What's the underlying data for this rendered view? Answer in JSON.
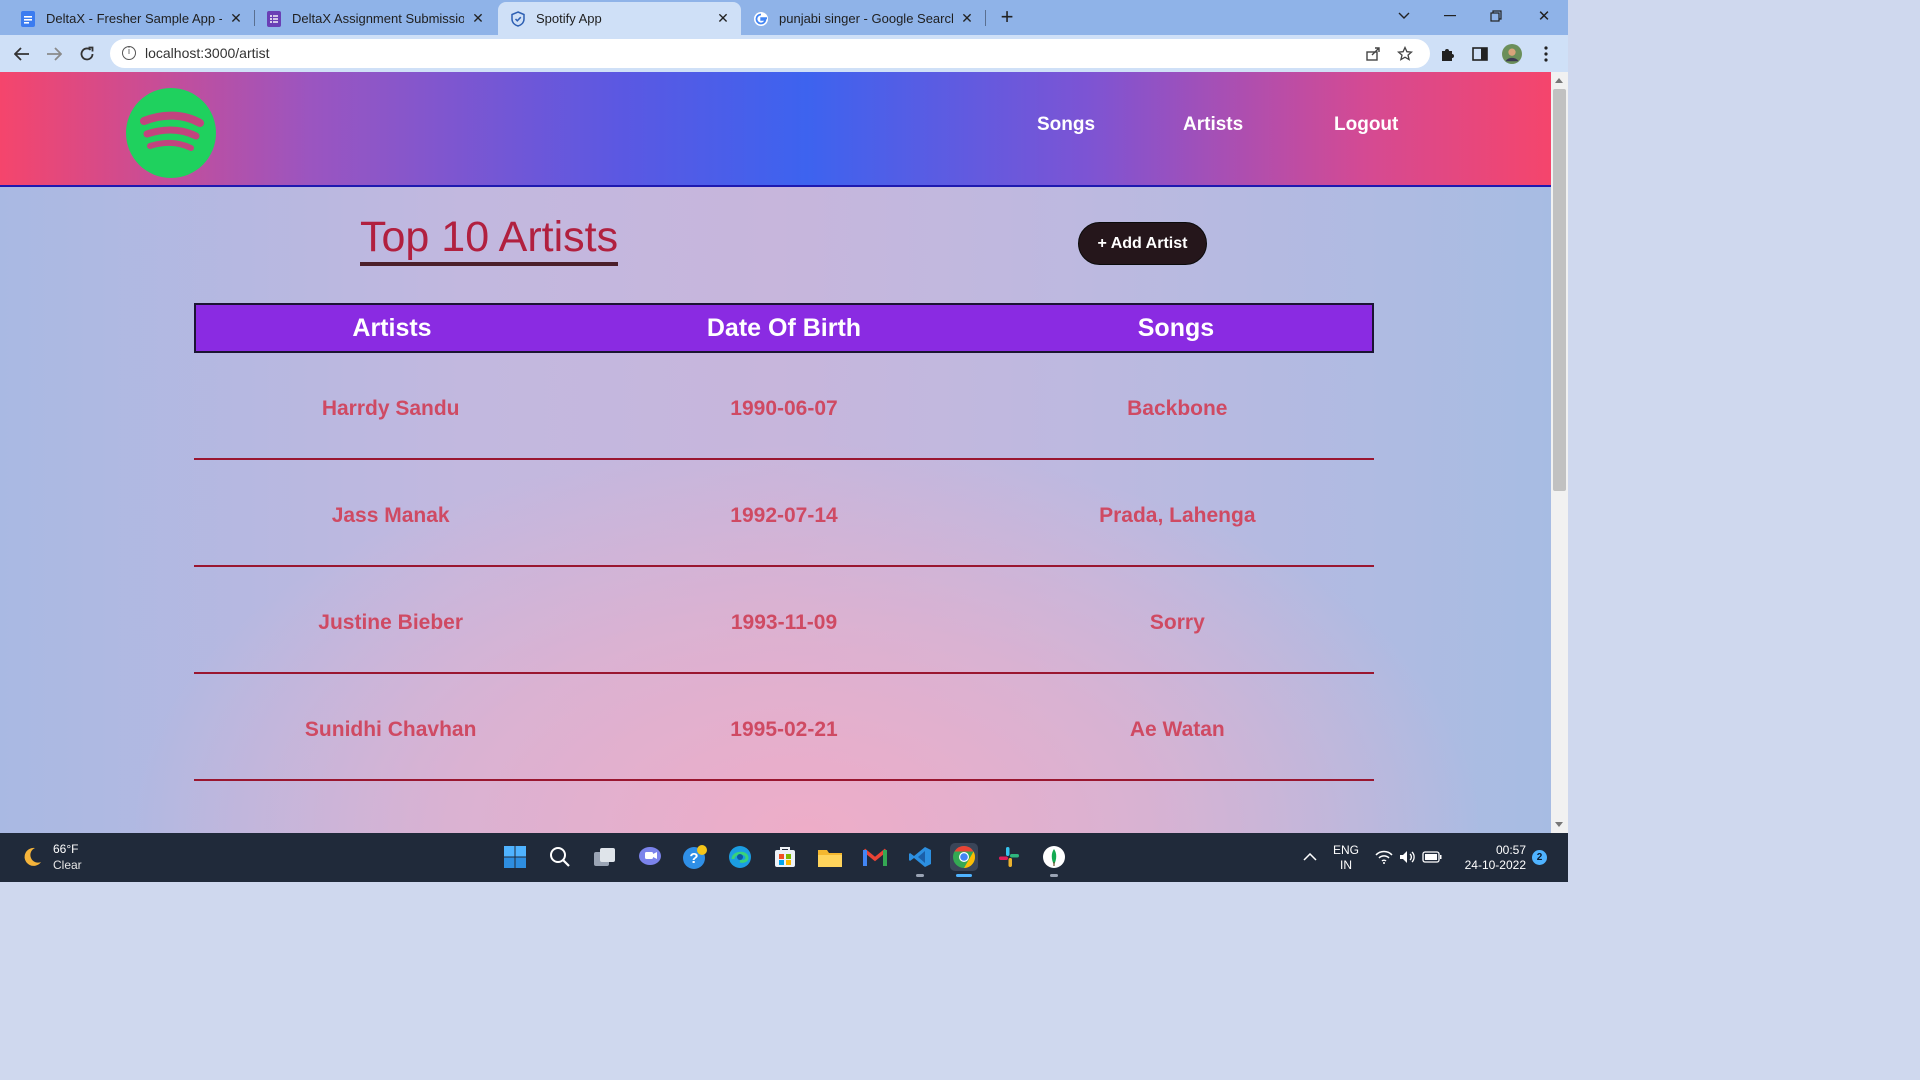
{
  "browser": {
    "tabs": [
      {
        "title": "DeltaX - Fresher Sample App - Sp",
        "favicon": "docs-icon",
        "active": false
      },
      {
        "title": "DeltaX Assignment Submission -",
        "favicon": "forms-icon",
        "active": false
      },
      {
        "title": "Spotify App",
        "favicon": "shield-icon",
        "active": true
      },
      {
        "title": "punjabi singer - Google Search",
        "favicon": "google-icon",
        "active": false
      }
    ],
    "url": "localhost:3000/artist"
  },
  "site": {
    "nav": {
      "songs": "Songs",
      "artists": "Artists",
      "logout": "Logout"
    },
    "brand_color": "#1fd15e"
  },
  "main": {
    "title": "Top 10 Artists",
    "add_button": "+ Add Artist",
    "table": {
      "headers": [
        "Artists",
        "Date Of Birth",
        "Songs"
      ],
      "rows": [
        {
          "artist": "Harrdy Sandu",
          "dob": "1990-06-07",
          "songs": "Backbone"
        },
        {
          "artist": "Jass Manak",
          "dob": "1992-07-14",
          "songs": "Prada, Lahenga"
        },
        {
          "artist": "Justine Bieber",
          "dob": "1993-11-09",
          "songs": "Sorry"
        },
        {
          "artist": "Sunidhi Chavhan",
          "dob": "1995-02-21",
          "songs": "Ae Watan"
        }
      ]
    }
  },
  "taskbar": {
    "weather": {
      "temp": "66°F",
      "desc": "Clear"
    },
    "lang": {
      "line1": "ENG",
      "line2": "IN"
    },
    "time": "00:57",
    "date": "24-10-2022",
    "notifications": "2"
  }
}
